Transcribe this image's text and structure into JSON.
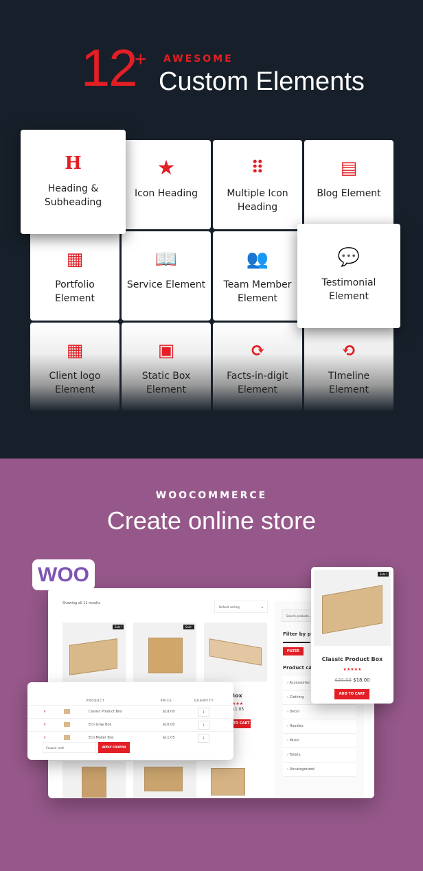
{
  "hero": {
    "number": "12",
    "plus": "+",
    "kicker": "AWESOME",
    "title": "Custom Elements",
    "accent": "#e31e24",
    "background": "#17202a"
  },
  "elements": [
    {
      "label": "Heading & Subheading",
      "icon": "heading-icon",
      "glyph": "H"
    },
    {
      "label": "Icon Heading",
      "icon": "star-icon",
      "glyph": "★"
    },
    {
      "label": "Multiple Icon Heading",
      "icon": "dots-grid-icon",
      "glyph": "⠿"
    },
    {
      "label": "Blog Element",
      "icon": "newspaper-icon",
      "glyph": "▤"
    },
    {
      "label": "Portfolio Element",
      "icon": "grid-icon",
      "glyph": "▦"
    },
    {
      "label": "Service Element",
      "icon": "book-icon",
      "glyph": "📖"
    },
    {
      "label": "Team Member Element",
      "icon": "users-icon",
      "glyph": "👥"
    },
    {
      "label": "Testimonial Element",
      "icon": "comments-icon",
      "glyph": "💬"
    },
    {
      "label": "Client logo Element",
      "icon": "th-icon",
      "glyph": "▦"
    },
    {
      "label": "Static Box Element",
      "icon": "boxes-icon",
      "glyph": "▣"
    },
    {
      "label": "Facts-in-digit Element",
      "icon": "refresh-icon",
      "glyph": "⟳"
    },
    {
      "label": "TImeline Element",
      "icon": "history-icon",
      "glyph": "⟲"
    }
  ],
  "woo": {
    "kicker": "WOOCOMMERCE",
    "title": "Create online store",
    "logo": "WOO",
    "background": "#96588a",
    "shop": {
      "results": "Showing all 11 results",
      "sorting": "Default sorting",
      "sale": "Sale!",
      "partial_title": "ailer Box",
      "partial_price": "11.05",
      "partial_btn": "TO CART",
      "search_placeholder": "Search products...",
      "filter_title": "Filter by pri",
      "filter_btn": "FILTER",
      "cat_title": "Product cate",
      "categories": [
        "Accessories",
        "Clothing",
        "Decor",
        "Hoodies",
        "Music",
        "Tshirts",
        "Uncategorized"
      ]
    },
    "cart": {
      "headers": [
        "PRODUCT",
        "PRICE",
        "QUANTITY"
      ],
      "rows": [
        {
          "name": "Classic Product Box",
          "price": "$18.00",
          "qty": "1"
        },
        {
          "name": "Eco Gray Box",
          "price": "$16.00",
          "qty": "1"
        },
        {
          "name": "Eco Mailer Box",
          "price": "$11.05",
          "qty": "1"
        }
      ],
      "coupon_placeholder": "Coupon code",
      "apply": "APPLY COUPON"
    },
    "product": {
      "sale": "Sale!",
      "name": "Classic Product Box",
      "rating": 4.5,
      "old_price": "$20.00",
      "price": "$18.00",
      "button": "ADD TO CART"
    }
  }
}
